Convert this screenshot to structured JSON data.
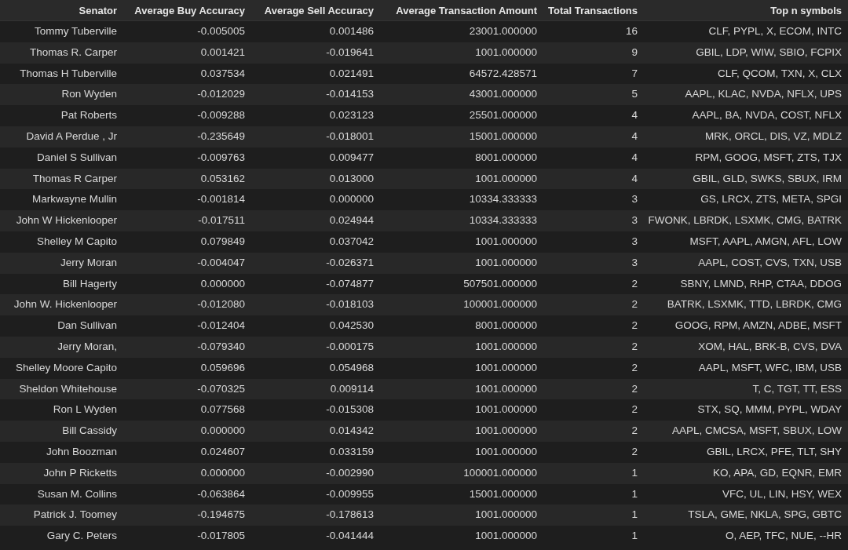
{
  "table": {
    "columns": [
      "Senator",
      "Average Buy Accuracy",
      "Average Sell Accuracy",
      "Average Transaction Amount",
      "Total Transactions",
      "Top n symbols"
    ],
    "rows": [
      [
        "Tommy Tuberville",
        "-0.005005",
        "0.001486",
        "23001.000000",
        "16",
        "CLF, PYPL, X, ECOM, INTC"
      ],
      [
        "Thomas R. Carper",
        "0.001421",
        "-0.019641",
        "1001.000000",
        "9",
        "GBIL, LDP, WIW, SBIO, FCPIX"
      ],
      [
        "Thomas H Tuberville",
        "0.037534",
        "0.021491",
        "64572.428571",
        "7",
        "CLF, QCOM, TXN, X, CLX"
      ],
      [
        "Ron Wyden",
        "-0.012029",
        "-0.014153",
        "43001.000000",
        "5",
        "AAPL, KLAC, NVDA, NFLX, UPS"
      ],
      [
        "Pat Roberts",
        "-0.009288",
        "0.023123",
        "25501.000000",
        "4",
        "AAPL, BA, NVDA, COST, NFLX"
      ],
      [
        "David A Perdue , Jr",
        "-0.235649",
        "-0.018001",
        "15001.000000",
        "4",
        "MRK, ORCL, DIS, VZ, MDLZ"
      ],
      [
        "Daniel S Sullivan",
        "-0.009763",
        "0.009477",
        "8001.000000",
        "4",
        "RPM, GOOG, MSFT, ZTS, TJX"
      ],
      [
        "Thomas R Carper",
        "0.053162",
        "0.013000",
        "1001.000000",
        "4",
        "GBIL, GLD, SWKS, SBUX, IRM"
      ],
      [
        "Markwayne Mullin",
        "-0.001814",
        "0.000000",
        "10334.333333",
        "3",
        "GS, LRCX, ZTS, META, SPGI"
      ],
      [
        "John W Hickenlooper",
        "-0.017511",
        "0.024944",
        "10334.333333",
        "3",
        "FWONK, LBRDK, LSXMK, CMG, BATRK"
      ],
      [
        "Shelley M Capito",
        "0.079849",
        "0.037042",
        "1001.000000",
        "3",
        "MSFT, AAPL, AMGN, AFL, LOW"
      ],
      [
        "Jerry Moran",
        "-0.004047",
        "-0.026371",
        "1001.000000",
        "3",
        "AAPL, COST, CVS, TXN, USB"
      ],
      [
        "Bill Hagerty",
        "0.000000",
        "-0.074877",
        "507501.000000",
        "2",
        "SBNY, LMND, RHP, CTAA, DDOG"
      ],
      [
        "John W. Hickenlooper",
        "-0.012080",
        "-0.018103",
        "100001.000000",
        "2",
        "BATRK, LSXMK, TTD, LBRDK, CMG"
      ],
      [
        "Dan Sullivan",
        "-0.012404",
        "0.042530",
        "8001.000000",
        "2",
        "GOOG, RPM, AMZN, ADBE, MSFT"
      ],
      [
        "Jerry Moran,",
        "-0.079340",
        "-0.000175",
        "1001.000000",
        "2",
        "XOM, HAL, BRK-B, CVS, DVA"
      ],
      [
        "Shelley Moore Capito",
        "0.059696",
        "0.054968",
        "1001.000000",
        "2",
        "AAPL, MSFT, WFC, IBM, USB"
      ],
      [
        "Sheldon Whitehouse",
        "-0.070325",
        "0.009114",
        "1001.000000",
        "2",
        "T, C, TGT, TT, ESS"
      ],
      [
        "Ron L Wyden",
        "0.077568",
        "-0.015308",
        "1001.000000",
        "2",
        "STX, SQ, MMM, PYPL, WDAY"
      ],
      [
        "Bill Cassidy",
        "0.000000",
        "0.014342",
        "1001.000000",
        "2",
        "AAPL, CMCSA, MSFT, SBUX, LOW"
      ],
      [
        "John Boozman",
        "0.024607",
        "0.033159",
        "1001.000000",
        "2",
        "GBIL, LRCX, PFE, TLT, SHY"
      ],
      [
        "John P Ricketts",
        "0.000000",
        "-0.002990",
        "100001.000000",
        "1",
        "KO, APA, GD, EQNR, EMR"
      ],
      [
        "Susan M. Collins",
        "-0.063864",
        "-0.009955",
        "15001.000000",
        "1",
        "VFC, UL, LIN, HSY, WEX"
      ],
      [
        "Patrick J. Toomey",
        "-0.194675",
        "-0.178613",
        "1001.000000",
        "1",
        "TSLA, GME, NKLA, SPG, GBTC"
      ],
      [
        "Gary C. Peters",
        "-0.017805",
        "-0.041444",
        "1001.000000",
        "1",
        "O, AEP, TFC, NUE, --HR"
      ]
    ]
  }
}
